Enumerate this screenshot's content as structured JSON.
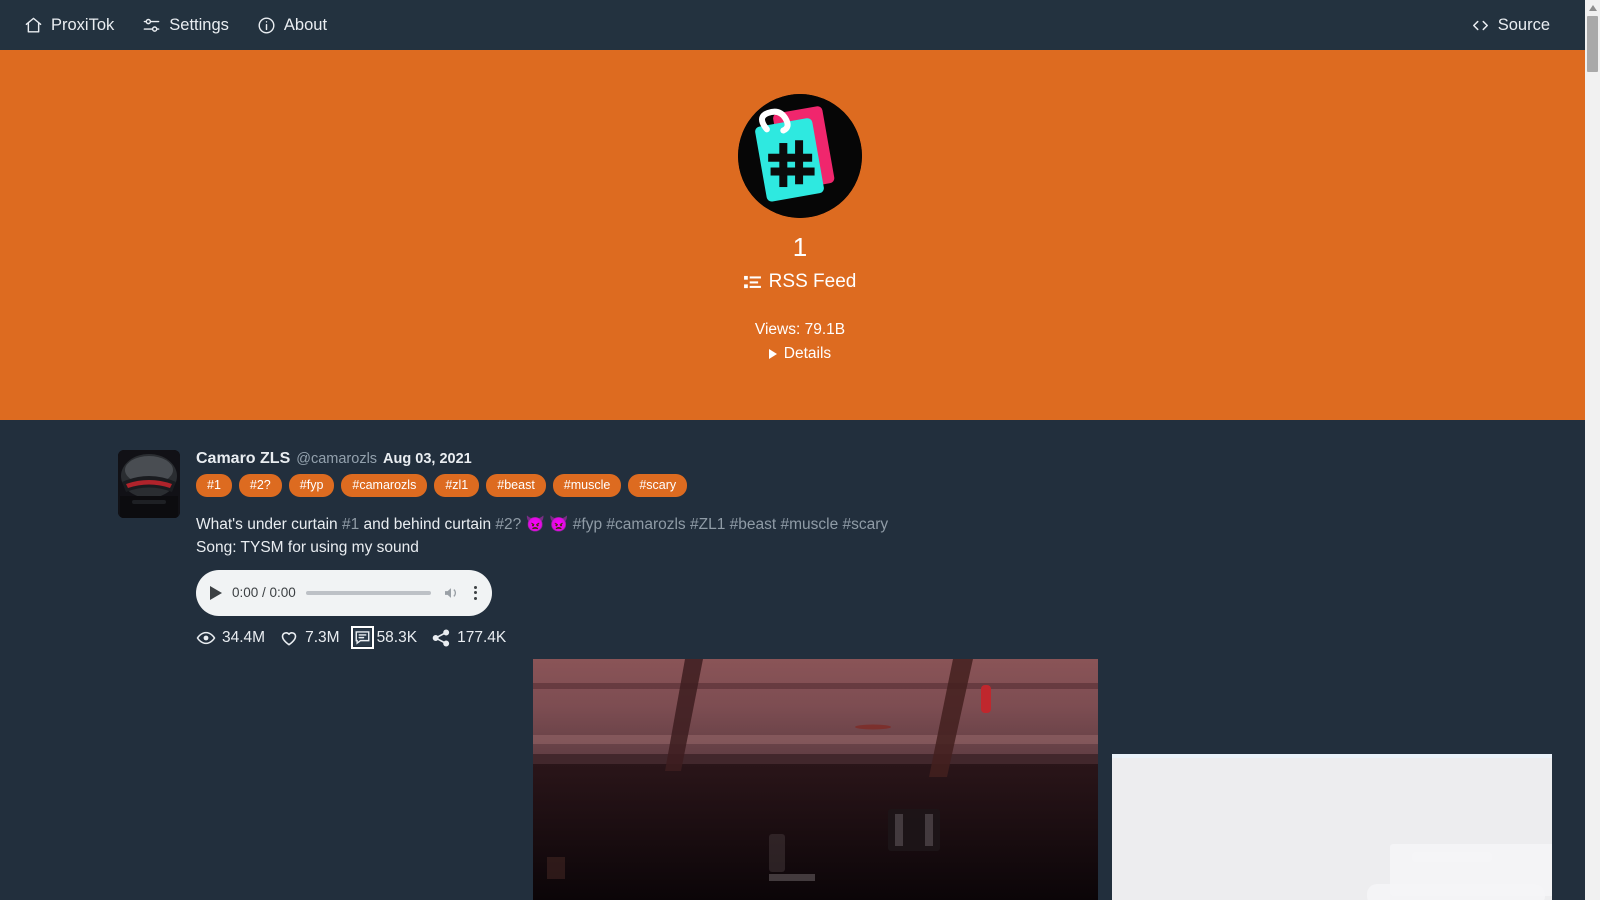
{
  "navbar": {
    "brand": "ProxiTok",
    "brand_icon": "home-icon",
    "items": [
      {
        "label": "Settings",
        "icon": "sliders-icon"
      },
      {
        "label": "About",
        "icon": "info-circle-icon"
      }
    ],
    "source": {
      "label": "Source",
      "icon": "code-brackets-icon"
    }
  },
  "scrollbar": {
    "orientation": "vertical",
    "position": "right"
  },
  "tag_header": {
    "avatar_icon": "hashtag-notebook-avatar",
    "title": "1",
    "rss": {
      "label": "RSS Feed",
      "icon": "rss-list-icon"
    },
    "views_label": "Views: 79.1B",
    "details": {
      "label": "Details",
      "icon": "triangle-right-icon"
    },
    "background_color": "#dd6b20"
  },
  "post": {
    "avatar_icon": "car-avatar",
    "author": "Camaro ZLS",
    "handle": "@camarozls",
    "date": "Aug 03, 2021",
    "pills": [
      "#1",
      "#2?",
      "#fyp",
      "#camarozls",
      "#zl1",
      "#beast",
      "#muscle",
      "#scary"
    ],
    "caption": {
      "line1_parts": [
        {
          "text": "What's under curtain ",
          "style": "normal"
        },
        {
          "text": "#1",
          "style": "muted"
        },
        {
          "text": " and behind curtain ",
          "style": "normal"
        },
        {
          "text": "#2?",
          "style": "muted"
        },
        {
          "text": " 👿 👿 ",
          "style": "emoji"
        },
        {
          "text": "#fyp",
          "style": "muted"
        },
        {
          "text": " ",
          "style": "normal"
        },
        {
          "text": "#camarozls",
          "style": "muted"
        },
        {
          "text": " ",
          "style": "normal"
        },
        {
          "text": "#ZL1",
          "style": "muted"
        },
        {
          "text": " ",
          "style": "normal"
        },
        {
          "text": "#beast",
          "style": "muted"
        },
        {
          "text": " ",
          "style": "normal"
        },
        {
          "text": "#muscle",
          "style": "muted"
        },
        {
          "text": " ",
          "style": "normal"
        },
        {
          "text": "#scary",
          "style": "muted"
        }
      ],
      "line2": "Song: TYSM for using my sound"
    },
    "audio": {
      "time": "0:00 / 0:00",
      "play_icon": "play-icon",
      "volume_icon": "volume-icon",
      "menu_icon": "kebab-menu-icon"
    },
    "stats": [
      {
        "icon": "eye-icon",
        "value": "34.4M",
        "name": "views"
      },
      {
        "icon": "heart-icon",
        "value": "7.3M",
        "name": "likes"
      },
      {
        "icon": "comment-icon",
        "value": "58.3K",
        "name": "comments",
        "highlighted": true
      },
      {
        "icon": "share-icon",
        "value": "177.4K",
        "name": "shares"
      }
    ]
  },
  "colors": {
    "navbar_bg": "#23323f",
    "page_bg": "#222f3d",
    "accent_orange": "#dd6b20",
    "text_light": "#e9edf1",
    "text_muted": "#8f9ba6"
  }
}
